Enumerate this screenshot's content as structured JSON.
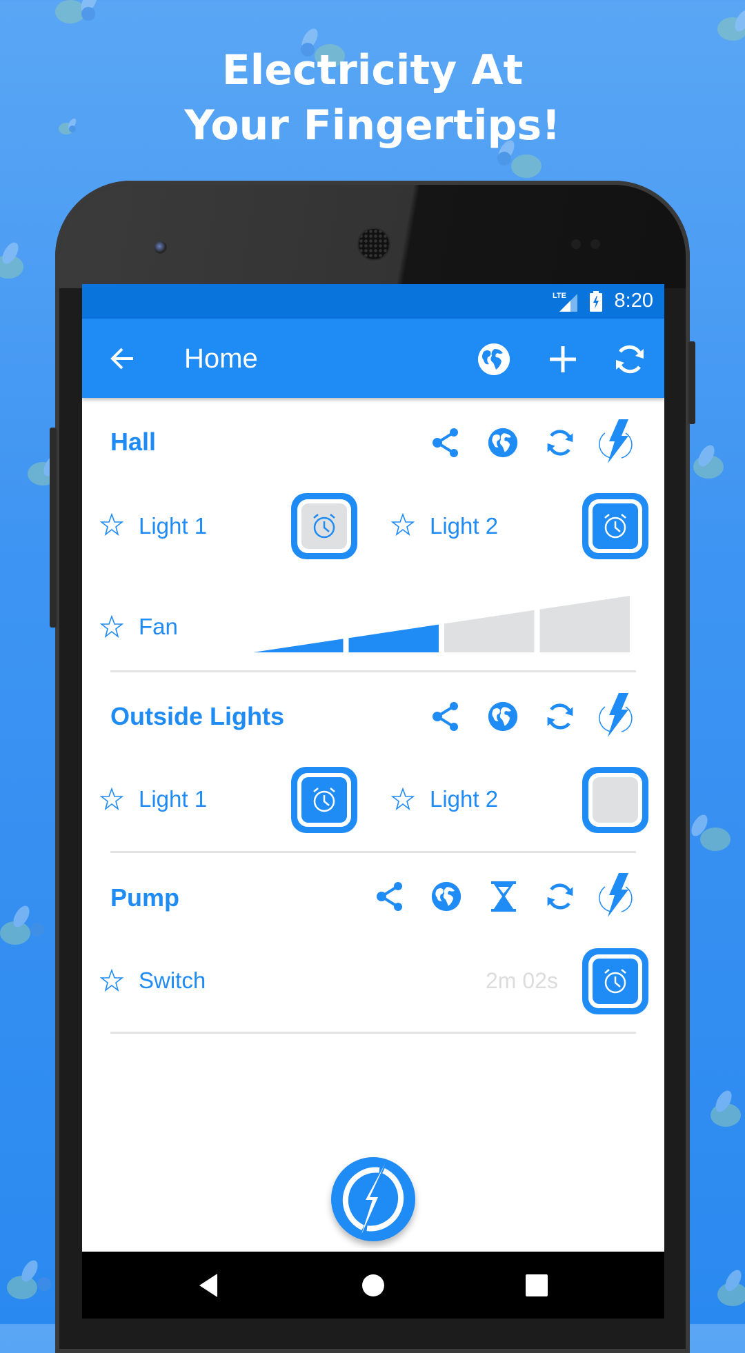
{
  "promo": {
    "headline_line1": "Electricity At",
    "headline_line2": "Your Fingertips!"
  },
  "status_bar": {
    "network": "LTE",
    "signal_icon": "signal-icon",
    "battery_icon": "battery-charging-icon",
    "time": "8:20"
  },
  "toolbar": {
    "back_icon": "arrow-back-icon",
    "title": "Home",
    "actions": [
      {
        "name": "globe-icon"
      },
      {
        "name": "add-icon"
      },
      {
        "name": "refresh-icon"
      }
    ]
  },
  "sections": [
    {
      "title": "Hall",
      "actions": [
        "share-icon",
        "globe-icon",
        "refresh-icon",
        "power-icon"
      ],
      "items": [
        {
          "label": "Light 1",
          "type": "toggle",
          "state": "off",
          "timer": true
        },
        {
          "label": "Light 2",
          "type": "toggle",
          "state": "on",
          "timer": true
        },
        {
          "label": "Fan",
          "type": "level",
          "level": 2,
          "max_level": 4
        }
      ]
    },
    {
      "title": "Outside Lights",
      "actions": [
        "share-icon",
        "globe-icon",
        "refresh-icon",
        "power-icon"
      ],
      "items": [
        {
          "label": "Light 1",
          "type": "toggle",
          "state": "on",
          "timer": true
        },
        {
          "label": "Light 2",
          "type": "toggle",
          "state": "off",
          "timer": false
        }
      ]
    },
    {
      "title": "Pump",
      "actions": [
        "share-icon",
        "globe-icon",
        "hourglass-icon",
        "refresh-icon",
        "power-icon"
      ],
      "items": [
        {
          "label": "Switch",
          "type": "toggle",
          "state": "on",
          "timer": true,
          "countdown": "2m 02s"
        }
      ]
    }
  ],
  "fab": {
    "icon": "power-bolt-icon"
  },
  "nav_bar": [
    "back",
    "home",
    "recents"
  ],
  "colors": {
    "accent": "#1f8bf5",
    "status_bar": "#0a74dd",
    "off_fill": "#dfe0e2",
    "divider": "#e2e2e2",
    "countdown_text": "#dcdcdc"
  }
}
